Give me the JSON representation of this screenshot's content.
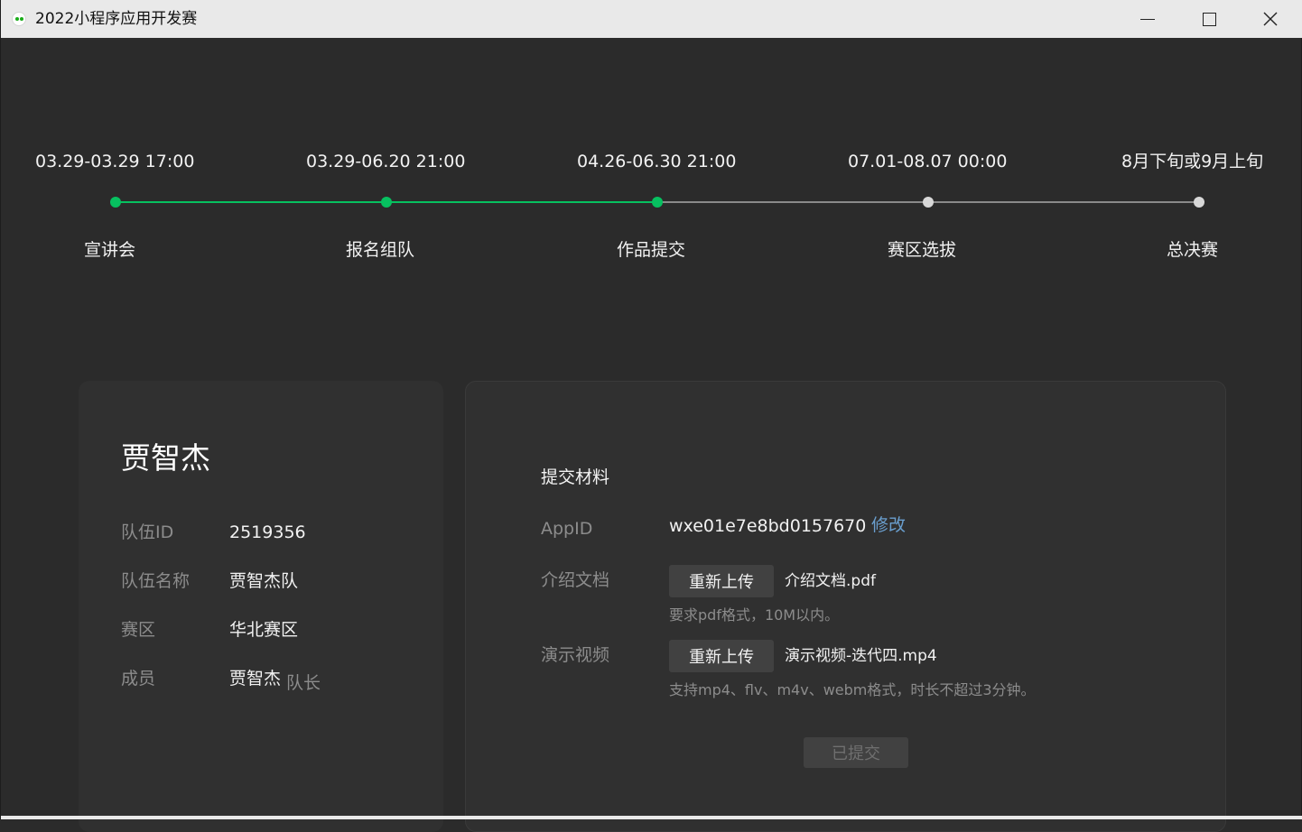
{
  "window": {
    "title": "2022小程序应用开发赛"
  },
  "timeline": {
    "stages": [
      {
        "date": "03.29-03.29 17:00",
        "name": "宣讲会",
        "done": true
      },
      {
        "date": "03.29-06.20 21:00",
        "name": "报名组队",
        "done": true
      },
      {
        "date": "04.26-06.30 21:00",
        "name": "作品提交",
        "done": true
      },
      {
        "date": "07.01-08.07 00:00",
        "name": "赛区选拔",
        "done": false
      },
      {
        "date": "8月下旬或9月上旬",
        "name": "总决赛",
        "done": false
      }
    ]
  },
  "team_card": {
    "name": "贾智杰",
    "team_id_label": "队伍ID",
    "team_id": "2519356",
    "team_name_label": "队伍名称",
    "team_name": "贾智杰队",
    "region_label": "赛区",
    "region": "华北赛区",
    "members_label": "成员",
    "member": "贾智杰",
    "captain_tag": "队长"
  },
  "submission": {
    "title": "提交材料",
    "appid_label": "AppID",
    "appid": "wxe01e7e8bd0157670",
    "edit_label": "修改",
    "doc_label": "介绍文档",
    "doc_button": "重新上传",
    "doc_file": "介绍文档.pdf",
    "doc_hint": "要求pdf格式，10M以内。",
    "video_label": "演示视频",
    "video_button": "重新上传",
    "video_file": "演示视频-迭代四.mp4",
    "video_hint": "支持mp4、flv、m4v、webm格式，时长不超过3分钟。",
    "submitted_label": "已提交"
  },
  "colors": {
    "accent_green": "#07c160",
    "link_blue": "#6a9fcf",
    "background": "#2b2b2b",
    "card": "#303030"
  }
}
